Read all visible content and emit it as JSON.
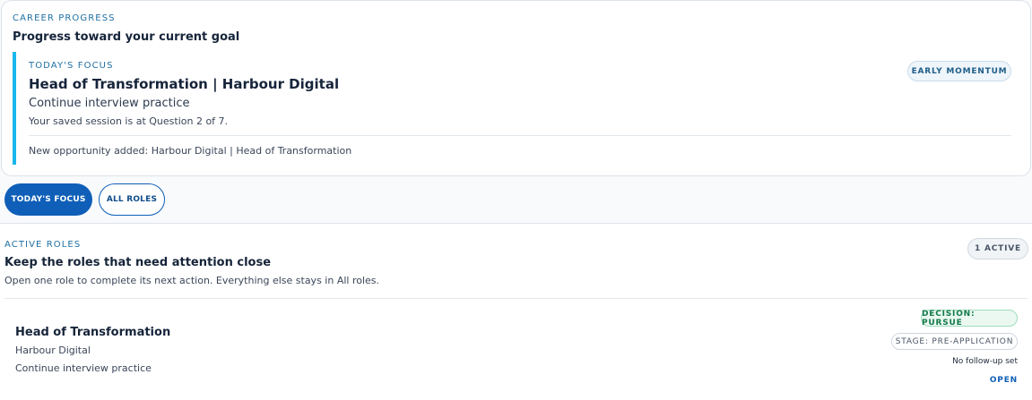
{
  "career_progress": {
    "eyebrow": "CAREER PROGRESS",
    "title": "Progress toward your current goal",
    "focus": {
      "eyebrow": "TODAY'S FOCUS",
      "role": "Head of Transformation | Harbour Digital",
      "action": "Continue interview practice",
      "session_status": "Your saved session is at Question 2 of 7.",
      "opportunity_note": "New opportunity added: Harbour Digital | Head of Transformation",
      "badge": "EARLY MOMENTUM"
    }
  },
  "tabs": [
    {
      "label": "TODAY'S FOCUS",
      "selected": true
    },
    {
      "label": "ALL ROLES",
      "selected": false
    }
  ],
  "active_roles": {
    "eyebrow": "ACTIVE ROLES",
    "title": "Keep the roles that need attention close",
    "subtitle": "Open one role to complete its next action. Everything else stays in All roles.",
    "count_badge": "1 ACTIVE",
    "roles": [
      {
        "title": "Head of Transformation",
        "company": "Harbour Digital",
        "next_action": "Continue interview practice",
        "decision_badge": "DECISION: PURSUE",
        "stage_badge": "STAGE: PRE-APPLICATION",
        "followup": "No follow-up set",
        "open_label": "OPEN"
      }
    ]
  },
  "colors": {
    "accent_blue": "#0f5fb8",
    "focus_bar": "#1ab6ec",
    "decision_green": "#137a4a"
  }
}
